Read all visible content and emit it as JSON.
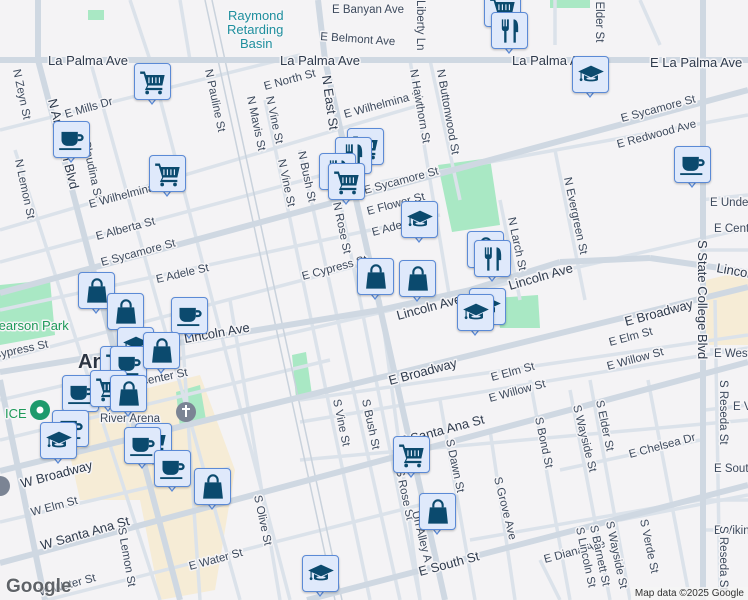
{
  "map": {
    "water_label": [
      "Raymond",
      "Retarding",
      "Basin"
    ],
    "park_label": "Pearson Park",
    "city_label": "Anaheim",
    "poi_labels": {
      "ice": "ICE",
      "arena": "River Arena"
    },
    "streets": {
      "la_palma_1": "La Palma Ave",
      "la_palma_2": "La Palma Ave",
      "la_palma_3": "La Palma Ave",
      "e_la_palma": "E La Palma Ave",
      "belmont": "E Belmont Ave",
      "liberty": "Liberty Ln",
      "zeyn": "N Zeyn St",
      "anaheim_blvd": "N Anaheim Blvd",
      "mills": "E Mills Dr",
      "pauline": "N Pauline St",
      "north": "E North St",
      "mavis": "N Mavis St",
      "vine_n1": "N Vine St",
      "vine_n2": "N Vine St",
      "bush_n": "N Bush St",
      "east_st": "N East St",
      "wilhelmina_e": "E Wilhelmina St",
      "wilhelmina_w": "E Wilhelmina St",
      "hawthorn": "N Hawthorn St",
      "buttonwood": "N Buttonwood St",
      "sycamore_e": "E Sycamore St",
      "redwood": "E Redwood Ave",
      "sycamore_m": "E Sycamore St",
      "flower": "E Flower St",
      "adele_m": "E Adele St",
      "rose_n": "N Rose St",
      "cypress_e": "E Cypress St",
      "larch": "N Larch St",
      "evergreen": "N Evergreen St",
      "lincoln_1": "Lincoln Ave",
      "lincoln_2": "Lincoln Ave",
      "lincoln_3": "Lincoln Ave",
      "lincoln_4": "Lincoln Ave",
      "state_college": "S State College Blvd",
      "broadway_e1": "E Broadway",
      "broadway_e2": "E Broadway",
      "elm_e1": "E Elm St",
      "willow_e1": "E Willow St",
      "elm_e2": "E Elm St",
      "willow_e2": "E Willow St",
      "santa_ana_e": "E Santa Ana St",
      "chelsea": "E Chelsea Dr",
      "bond": "S Bond St",
      "wayside": "S Wayside St",
      "elder": "S Elder St",
      "vine_s": "S Vine St",
      "bush_s": "S Bush St",
      "dawn": "S Dawn St",
      "grove": "S Grove Ave",
      "rose_s": "S Rose St",
      "alley": "Un Alley A",
      "south_e": "E South St",
      "diana": "E Diana Ave",
      "broadway_w": "W Broadway",
      "elm_w": "W Elm St",
      "santa_ana_w": "W Santa Ana St",
      "lemon_s": "S Lemon St",
      "olive": "S Olive St",
      "water_e": "E Water St",
      "water_w": "W Water St",
      "lemon_n": "N Lemon St",
      "claudina": "N Claudina St",
      "alberta": "E Alberta St",
      "sycamore_w": "E Sycamore St",
      "adele_w": "E Adele St",
      "cypress_w": "W Cypress St",
      "center": "E Center St",
      "under": "E Underhill Ave",
      "center_e": "E Center St",
      "west": "E Westport Dr",
      "vi": "E Vine St",
      "south_r": "E South St",
      "viking": "E Viking Way",
      "reseda_1": "S Reseda St",
      "reseda_2": "S Reseda St",
      "barnett": "S Barnett St",
      "wayside_2": "S Wayside St",
      "verde": "S Verde St",
      "linc": "S Lincoln St",
      "banyan": "E Banyan Ave",
      "elder_n": "N Elder St"
    }
  },
  "poi_markers": [
    {
      "type": "shopping-cart"
    },
    {
      "type": "restaurant"
    },
    {
      "type": "shopping-cart"
    },
    {
      "type": "education"
    },
    {
      "type": "cafe"
    },
    {
      "type": "shopping-cart"
    },
    {
      "type": "restaurant"
    },
    {
      "type": "restaurant"
    },
    {
      "type": "shopping-cart"
    },
    {
      "type": "shopping-cart"
    },
    {
      "type": "cafe"
    },
    {
      "type": "education"
    },
    {
      "type": "shopping-bag"
    },
    {
      "type": "restaurant"
    },
    {
      "type": "shopping-bag"
    },
    {
      "type": "shopping-bag"
    },
    {
      "type": "shopping-bag"
    },
    {
      "type": "education"
    },
    {
      "type": "education"
    },
    {
      "type": "shopping-bag"
    },
    {
      "type": "cafe"
    },
    {
      "type": "education"
    },
    {
      "type": "shopping-cart"
    },
    {
      "type": "cafe"
    },
    {
      "type": "shopping-bag"
    },
    {
      "type": "cafe"
    },
    {
      "type": "shopping-cart"
    },
    {
      "type": "shopping-bag"
    },
    {
      "type": "cafe"
    },
    {
      "type": "education"
    },
    {
      "type": "shopping-cart"
    },
    {
      "type": "cafe"
    },
    {
      "type": "cafe"
    },
    {
      "type": "shopping-bag"
    },
    {
      "type": "shopping-cart"
    },
    {
      "type": "shopping-bag"
    },
    {
      "type": "education"
    }
  ],
  "colors": {
    "marker_icon": "#0b4a6e",
    "marker_bg": "#dfe9fb",
    "marker_border": "#5b8ad6",
    "park": "#a9e8c4",
    "downtown": "#f6ecd6"
  },
  "footer": {
    "attribution": "Map data ©2025 Google",
    "logo": "Google"
  }
}
